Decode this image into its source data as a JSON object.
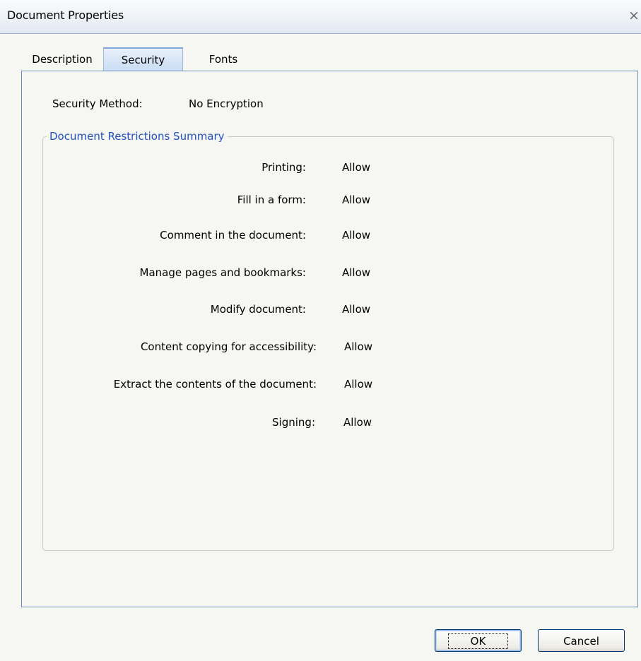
{
  "window": {
    "title": "Document Properties",
    "close_glyph": "×"
  },
  "tabs": [
    {
      "label": "Description",
      "active": false
    },
    {
      "label": "Security",
      "active": true
    },
    {
      "label": "Fonts",
      "active": false
    }
  ],
  "security": {
    "method_label": "Security Method:",
    "method_value": "No Encryption"
  },
  "restrictions": {
    "title": "Document Restrictions Summary",
    "rows": [
      {
        "label": "Printing:",
        "value": "Allow"
      },
      {
        "label": "Fill in a form:",
        "value": "Allow"
      },
      {
        "label": "Comment in the document:",
        "value": "Allow"
      },
      {
        "label": "Manage pages and bookmarks:",
        "value": "Allow"
      },
      {
        "label": "Modify document:",
        "value": "Allow"
      },
      {
        "label": "Content copying for accessibility:",
        "value": "Allow"
      },
      {
        "label": "Extract the contents of the document:",
        "value": "Allow"
      },
      {
        "label": "Signing:",
        "value": "Allow"
      }
    ]
  },
  "buttons": {
    "ok_label": "OK",
    "cancel_label": "Cancel"
  },
  "colors": {
    "group_title": "#2050c8",
    "panel_border": "#6d8fbf",
    "active_tab": "#c9dcf4"
  }
}
